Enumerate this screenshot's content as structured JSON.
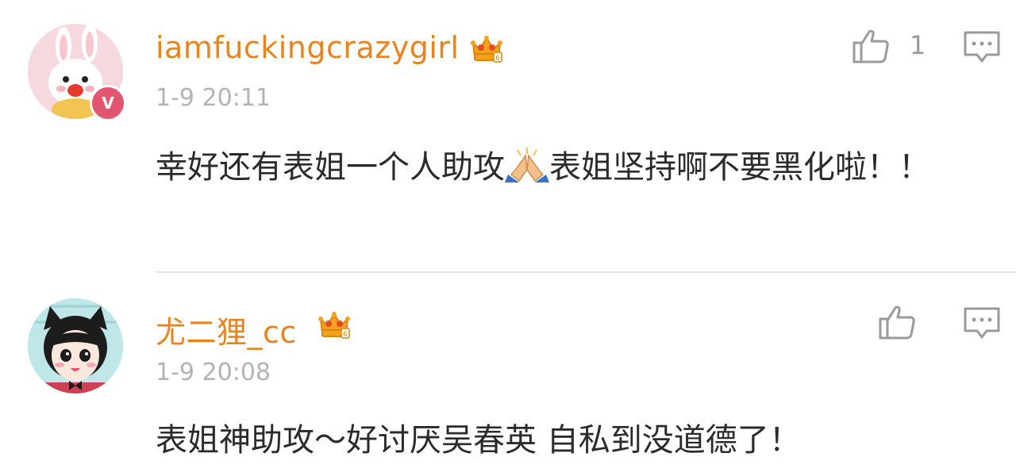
{
  "comments": [
    {
      "username": "iamfuckingcrazygirl",
      "timestamp": "1-9 20:11",
      "verified_badge": "V",
      "likes": "1",
      "text_before_emoji": "幸好还有表姐一个人助攻",
      "emoji": "folded-hands-emoji",
      "text_after_emoji": "表姐坚持啊不要黑化啦！！",
      "avatar": "bunny-avatar",
      "level_badge": "crown-icon"
    },
    {
      "username": "尤二狸_cc",
      "timestamp": "1-9 20:08",
      "text": "表姐神助攻～好讨厌吴春英 自私到没道德了！",
      "avatar": "cat-girl-avatar",
      "level_badge": "crown-icon"
    }
  ],
  "colors": {
    "username": "#e8841f",
    "timestamp": "#b3b3b3",
    "text": "#2b2b2b",
    "icon": "#9a9a9a",
    "divider": "#e6e6e6"
  }
}
